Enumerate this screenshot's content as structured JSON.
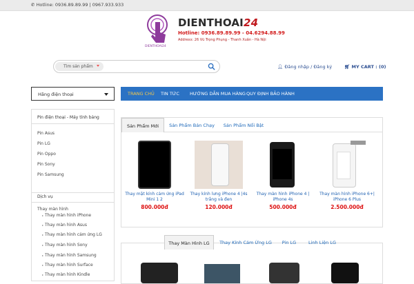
{
  "topbar": {
    "hotline_text": "Hotline: 0936.89.89.99 | 0967.933.933"
  },
  "logo": {
    "brand_main": "DIENTHOAI",
    "brand_num": "24",
    "hand_caption": "DIENTHOAI24",
    "hotline": "Hotline: 0936.89.89.99 - 04.6294.88.99",
    "address": "Addrexx: 26 Vũ Trọng Phụng - Thanh Xuân - Hà Nội"
  },
  "search": {
    "category": "Tìm sản phẩm",
    "placeholder": ""
  },
  "account": {
    "login": "Đăng nhập / Đăng ký",
    "cart": "MY CART : (0)"
  },
  "category_dropdown": "Hãng điện thoại",
  "nav": [
    "TRANG CHỦ",
    "TIN TỨC",
    "HƯỚNG DẪN MUA HÀNG",
    "QUY ĐỊNH BẢO HÀNH"
  ],
  "sidebar": {
    "section1_title": "Pin điện thoại - Máy tính bảng",
    "section1_items": [
      "Pin Asus",
      "Pin LG",
      "Pin Oppo",
      "Pin Sony",
      "Pin Samsung"
    ],
    "section2_title": "Dịch vụ",
    "section2_parent": "Thay màn hình",
    "section2_items": [
      "Thay màn hình iPhone",
      "Thay màn hình Asus",
      "Thay màn hình cảm ứng LG",
      "Thay màn hình Sony",
      "Thay màn hình Samsung",
      "Thay màn hình Surface",
      "Thay màn hình Kindle"
    ]
  },
  "box1": {
    "tabs": [
      "Sản Phẩm Mới",
      "Sản Phẩm Bán Chạy",
      "Sản Phẩm Nổi Bật"
    ],
    "products": [
      {
        "name": "Thay mặt kính cảm ứng iPad Mini 1 2",
        "price": "800.000đ"
      },
      {
        "name": "Thay kính lưng iPhone 4 |4s trắng và đen",
        "price": "120.000đ"
      },
      {
        "name": "Thay màn hình iPhone 4 | iPhone 4s",
        "price": "500.000đ"
      },
      {
        "name": "Thay màn hình iPhone 6+| iPhone 6 Plus",
        "price": "2.500.000đ"
      }
    ]
  },
  "box2": {
    "tabs": [
      "Thay Màn Hình LG",
      "Thay Kính Cảm Ứng LG",
      "Pin LG",
      "Linh Liện LG"
    ]
  },
  "colors": {
    "nav_blue": "#2b72c4",
    "price_red": "#dd1111",
    "link_blue": "#1d5fb0"
  }
}
